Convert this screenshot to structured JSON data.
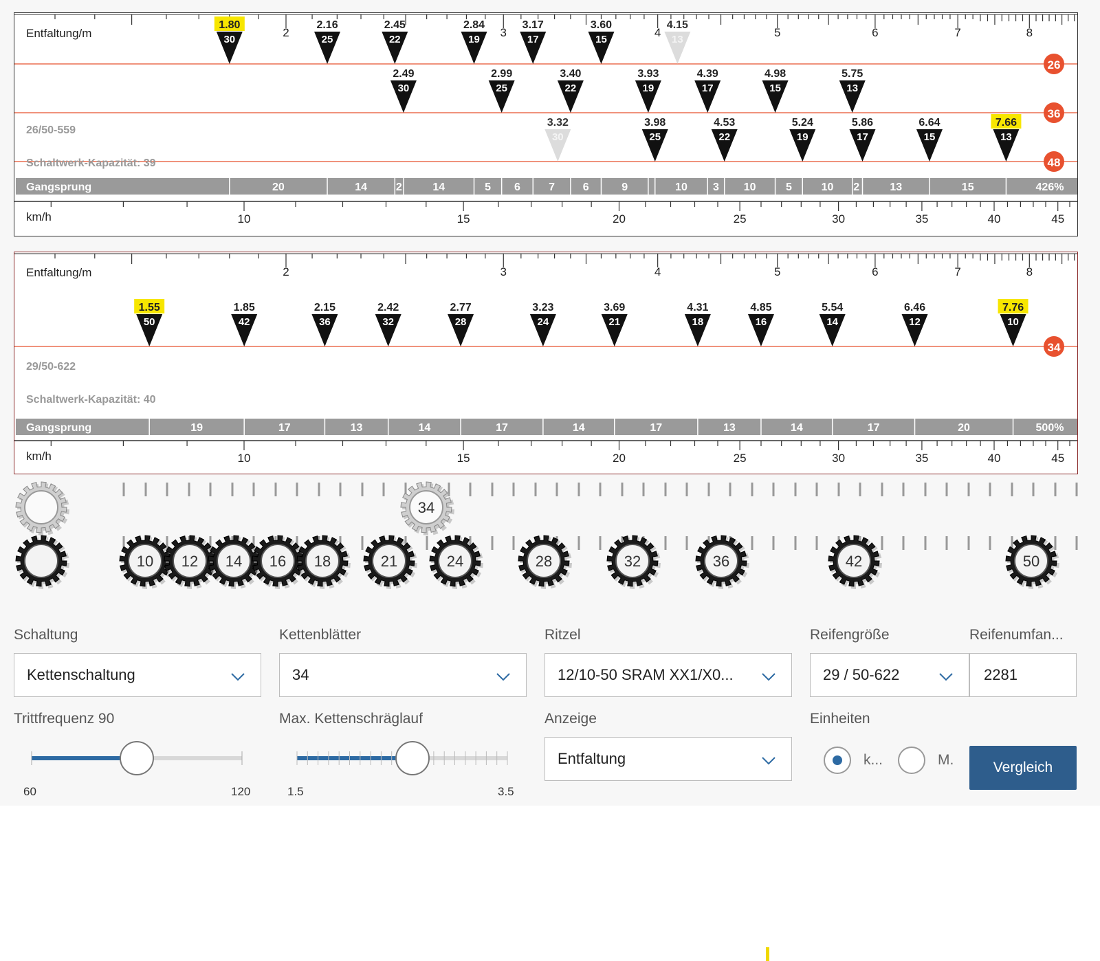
{
  "panel1": {
    "label_entfaltung": "Entfaltung/m",
    "label_kmh": "km/h",
    "setup_label": "26/50-559",
    "capacity_label": "Schaltwerk-Kapazität: 39",
    "ticks_top": [
      "2",
      "3",
      "4",
      "5",
      "6",
      "7",
      "8"
    ],
    "ticks_bottom": [
      "10",
      "15",
      "20",
      "25",
      "30",
      "35",
      "40",
      "45"
    ],
    "rows": [
      {
        "chainring": "26",
        "gears": [
          {
            "dev": "1.80",
            "cog": "30",
            "highlight": true,
            "ghost": false
          },
          {
            "dev": "2.16",
            "cog": "25",
            "highlight": false,
            "ghost": false
          },
          {
            "dev": "2.45",
            "cog": "22",
            "highlight": false,
            "ghost": false
          },
          {
            "dev": "2.84",
            "cog": "19",
            "highlight": false,
            "ghost": false
          },
          {
            "dev": "3.17",
            "cog": "17",
            "highlight": false,
            "ghost": false
          },
          {
            "dev": "3.60",
            "cog": "15",
            "highlight": false,
            "ghost": false
          },
          {
            "dev": "4.15",
            "cog": "13",
            "highlight": false,
            "ghost": true
          }
        ]
      },
      {
        "chainring": "36",
        "gears": [
          {
            "dev": "2.49",
            "cog": "30",
            "highlight": false,
            "ghost": false
          },
          {
            "dev": "2.99",
            "cog": "25",
            "highlight": false,
            "ghost": false
          },
          {
            "dev": "3.40",
            "cog": "22",
            "highlight": false,
            "ghost": false
          },
          {
            "dev": "3.93",
            "cog": "19",
            "highlight": false,
            "ghost": false
          },
          {
            "dev": "4.39",
            "cog": "17",
            "highlight": false,
            "ghost": false
          },
          {
            "dev": "4.98",
            "cog": "15",
            "highlight": false,
            "ghost": false
          },
          {
            "dev": "5.75",
            "cog": "13",
            "highlight": false,
            "ghost": false
          }
        ]
      },
      {
        "chainring": "48",
        "gears": [
          {
            "dev": "3.32",
            "cog": "30",
            "highlight": false,
            "ghost": true
          },
          {
            "dev": "3.98",
            "cog": "25",
            "highlight": false,
            "ghost": false
          },
          {
            "dev": "4.53",
            "cog": "22",
            "highlight": false,
            "ghost": false
          },
          {
            "dev": "5.24",
            "cog": "19",
            "highlight": false,
            "ghost": false
          },
          {
            "dev": "5.86",
            "cog": "17",
            "highlight": false,
            "ghost": false
          },
          {
            "dev": "6.64",
            "cog": "15",
            "highlight": false,
            "ghost": false
          },
          {
            "dev": "7.66",
            "cog": "13",
            "highlight": true,
            "ghost": false
          }
        ]
      }
    ],
    "gangsprung_label": "Gangsprung",
    "gangsprung_total": "426%",
    "gangsprung_steps": [
      {
        "v": 1.8,
        "t": "20"
      },
      {
        "v": 2.16,
        "t": "14"
      },
      {
        "v": 2.45,
        "t": "2"
      },
      {
        "v": 2.49,
        "t": "14"
      },
      {
        "v": 2.84,
        "t": "5"
      },
      {
        "v": 2.99,
        "t": "6"
      },
      {
        "v": 3.17,
        "t": "7"
      },
      {
        "v": 3.4,
        "t": "6"
      },
      {
        "v": 3.6,
        "t": "9"
      },
      {
        "v": 3.93,
        "t": ""
      },
      {
        "v": 3.98,
        "t": "10"
      },
      {
        "v": 4.39,
        "t": "3"
      },
      {
        "v": 4.53,
        "t": "10"
      },
      {
        "v": 4.98,
        "t": "5"
      },
      {
        "v": 5.24,
        "t": "10"
      },
      {
        "v": 5.75,
        "t": "2"
      },
      {
        "v": 5.86,
        "t": "13"
      },
      {
        "v": 6.64,
        "t": "15"
      },
      {
        "v": 7.66,
        "t": ""
      }
    ]
  },
  "panel2": {
    "label_entfaltung": "Entfaltung/m",
    "label_kmh": "km/h",
    "setup_label": "29/50-622",
    "capacity_label": "Schaltwerk-Kapazität: 40",
    "ticks_top": [
      "2",
      "3",
      "4",
      "5",
      "6",
      "7",
      "8"
    ],
    "ticks_bottom": [
      "10",
      "15",
      "20",
      "25",
      "30",
      "35",
      "40",
      "45"
    ],
    "rows": [
      {
        "chainring": "34",
        "gears": [
          {
            "dev": "1.55",
            "cog": "50",
            "highlight": true,
            "ghost": false
          },
          {
            "dev": "1.85",
            "cog": "42",
            "highlight": false,
            "ghost": false
          },
          {
            "dev": "2.15",
            "cog": "36",
            "highlight": false,
            "ghost": false
          },
          {
            "dev": "2.42",
            "cog": "32",
            "highlight": false,
            "ghost": false
          },
          {
            "dev": "2.77",
            "cog": "28",
            "highlight": false,
            "ghost": false
          },
          {
            "dev": "3.23",
            "cog": "24",
            "highlight": false,
            "ghost": false
          },
          {
            "dev": "3.69",
            "cog": "21",
            "highlight": false,
            "ghost": false
          },
          {
            "dev": "4.31",
            "cog": "18",
            "highlight": false,
            "ghost": false
          },
          {
            "dev": "4.85",
            "cog": "16",
            "highlight": false,
            "ghost": false
          },
          {
            "dev": "5.54",
            "cog": "14",
            "highlight": false,
            "ghost": false
          },
          {
            "dev": "6.46",
            "cog": "12",
            "highlight": false,
            "ghost": false
          },
          {
            "dev": "7.76",
            "cog": "10",
            "highlight": true,
            "ghost": false
          }
        ]
      }
    ],
    "gangsprung_label": "Gangsprung",
    "gangsprung_total": "500%",
    "gangsprung_steps": [
      {
        "v": 1.55,
        "t": "19"
      },
      {
        "v": 1.85,
        "t": "17"
      },
      {
        "v": 2.15,
        "t": "13"
      },
      {
        "v": 2.42,
        "t": "14"
      },
      {
        "v": 2.77,
        "t": "17"
      },
      {
        "v": 3.23,
        "t": "14"
      },
      {
        "v": 3.69,
        "t": "17"
      },
      {
        "v": 4.31,
        "t": "13"
      },
      {
        "v": 4.85,
        "t": "14"
      },
      {
        "v": 5.54,
        "t": "17"
      },
      {
        "v": 6.46,
        "t": "20"
      },
      {
        "v": 7.76,
        "t": ""
      }
    ]
  },
  "gears": {
    "chainrings": [
      "34"
    ],
    "cogs": [
      "10",
      "12",
      "14",
      "16",
      "18",
      "21",
      "24",
      "28",
      "32",
      "36",
      "42",
      "50"
    ]
  },
  "controls": {
    "schaltung": {
      "label": "Schaltung",
      "value": "Kettenschaltung"
    },
    "kettenblaetter": {
      "label": "Kettenblätter",
      "value": "34"
    },
    "ritzel": {
      "label": "Ritzel",
      "value": "12/10-50 SRAM XX1/X0..."
    },
    "reifengroesse": {
      "label": "Reifengröße",
      "value": "29 / 50-622"
    },
    "reifenumfang": {
      "label": "Reifenumfan...",
      "value": "2281"
    },
    "trittfrequenz": {
      "label": "Trittfrequenz 90",
      "min": "60",
      "max": "120",
      "value": 90
    },
    "kettenschraeglauf": {
      "label": "Max. Kettenschräglauf",
      "min": "1.5",
      "max": "3.5",
      "value": 2.5
    },
    "anzeige": {
      "label": "Anzeige",
      "value": "Entfaltung"
    },
    "einheiten": {
      "label": "Einheiten",
      "option1": "k...",
      "option2": "M.",
      "selected": "option1"
    },
    "vergleich_button": "Vergleich"
  },
  "colors": {
    "accent_red": "#e8512f",
    "highlight_yellow": "#f7e600",
    "gangsprung_bar": "#9a9a9a",
    "button_blue": "#2e5d8c",
    "slider_blue": "#2d6aa3"
  }
}
